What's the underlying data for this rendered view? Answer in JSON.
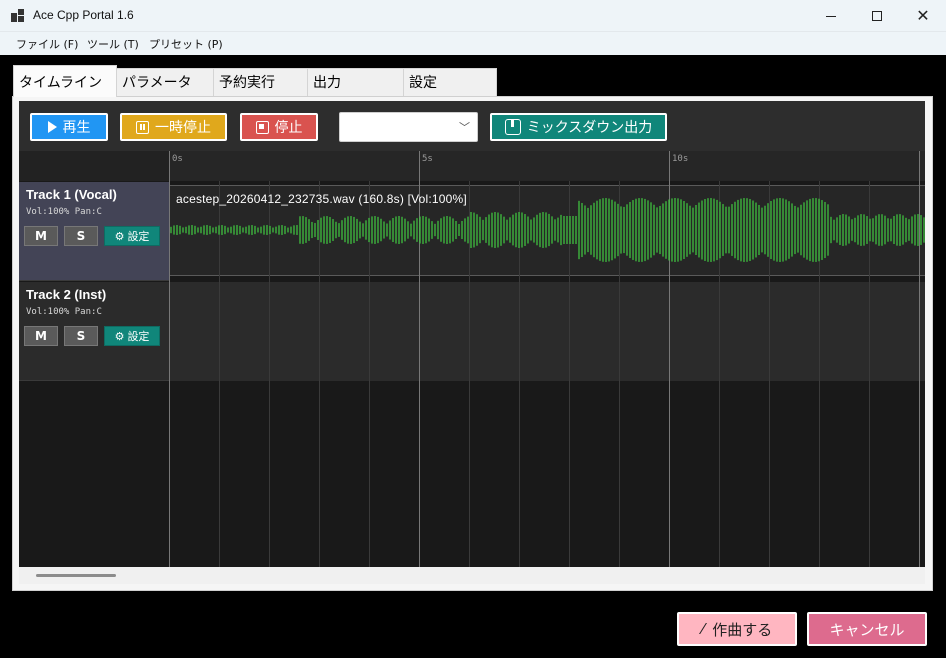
{
  "window": {
    "title": "Ace Cpp Portal 1.6",
    "close_glyph": "✕"
  },
  "menu": [
    {
      "label": "ファイル (F)"
    },
    {
      "label": "ツール (T)"
    },
    {
      "label": "プリセット (P)"
    }
  ],
  "tabs": [
    {
      "label": "タイムライン",
      "active": true
    },
    {
      "label": "パラメータ"
    },
    {
      "label": "予約実行"
    },
    {
      "label": "出力"
    },
    {
      "label": "設定"
    }
  ],
  "toolbar": {
    "play_label": "再生",
    "pause_label": "一時停止",
    "stop_label": "停止",
    "combo_value": "",
    "mixdown_label": "ミックスダウン出力",
    "colors": {
      "play": "#2196f3",
      "pause": "#e0a81c",
      "stop": "#d9534f",
      "mixdown": "#10867a"
    }
  },
  "ruler": {
    "ticks": [
      "0s",
      "5s",
      "10s"
    ]
  },
  "tracks": [
    {
      "name": "Track 1 (Vocal)",
      "info": "Vol:100% Pan:C",
      "mute_label": "M",
      "solo_label": "S",
      "settings_label": "設定",
      "selected": true,
      "clip": {
        "label": "acestep_20260412_232735.wav  (160.8s)  [Vol:100%]",
        "waveform_color": "#3fbf3f"
      }
    },
    {
      "name": "Track 2 (Inst)",
      "info": "Vol:100% Pan:C",
      "mute_label": "M",
      "solo_label": "S",
      "settings_label": "設定",
      "selected": false
    }
  ],
  "footer": {
    "compose_label": "作曲する",
    "cancel_label": "キャンセル",
    "colors": {
      "compose": "#ffb6c1",
      "cancel": "#dd6b8e"
    }
  },
  "icons": [
    "app-icon",
    "minimize-icon",
    "maximize-icon",
    "close-icon",
    "play-icon",
    "pause-icon",
    "stop-icon",
    "chevron-down-icon",
    "mixdown-icon",
    "gear-icon",
    "magic-wand-icon"
  ]
}
